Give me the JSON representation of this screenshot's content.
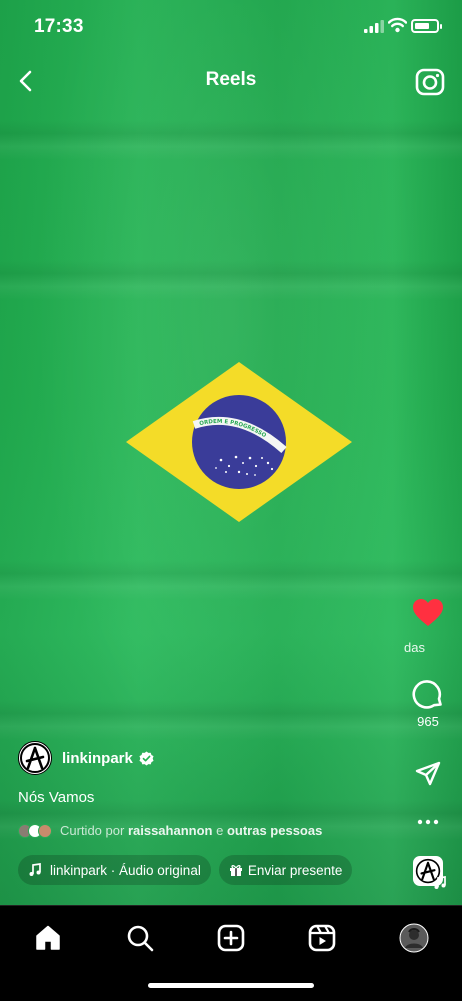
{
  "status_bar": {
    "time": "17:33",
    "battery_level": 0.7
  },
  "header": {
    "title": "Reels"
  },
  "actions": {
    "likes_label": "das",
    "comments_count": "965"
  },
  "post": {
    "username": "linkinpark",
    "caption": "Nós Vamos",
    "liked_prefix": "Curtido por",
    "liked_user": "raissahannon",
    "liked_conj": "e",
    "liked_others": "outras pessoas",
    "audio_label": "linkinpark · Áudio original",
    "gift_label": "Enviar presente"
  },
  "flag": {
    "banner_text": "ORDEM E PROGRESSO"
  },
  "colors": {
    "background_green": "#22b452",
    "flag_yellow": "#f4dc28",
    "flag_blue": "#3a3c99",
    "like_red": "#ff3040"
  },
  "icons": {
    "back": "chevron-left-icon",
    "camera": "camera-icon",
    "like": "heart-filled-icon",
    "comment": "comment-icon",
    "share": "send-icon",
    "more": "more-horizontal-icon",
    "home": "home-icon",
    "search": "search-icon",
    "create": "plus-square-icon",
    "reels": "reels-icon",
    "profile": "profile-avatar"
  }
}
